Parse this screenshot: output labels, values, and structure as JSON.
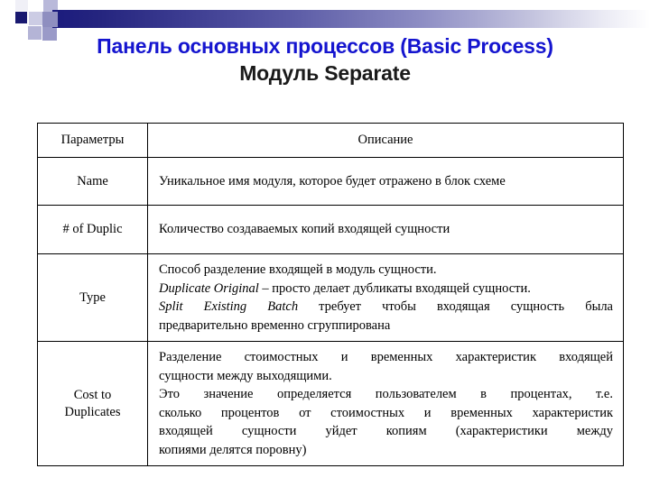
{
  "slide": {
    "title_line_1": "Панель основных процессов (Basic Process)",
    "title_line_2": "Модуль Separate",
    "title_color_1": "#1515cf",
    "title_color_2": "#1a1a1a",
    "banner_gradient_start": "#1b1b7d",
    "banner_gradient_end": "#ffffff",
    "accent_square_color": "#191970"
  },
  "table": {
    "headers": {
      "parameter": "Параметры",
      "description": "Описание"
    },
    "rows": [
      {
        "parameter": "Name",
        "description_lines": [
          {
            "text": "Уникальное имя модуля, которое будет отражено в блок схеме",
            "justify": false
          }
        ]
      },
      {
        "parameter": "# of Duplic",
        "description_lines": [
          {
            "text": "Количество создаваемых копий входящей сущности",
            "justify": false
          }
        ]
      },
      {
        "parameter": "Type",
        "description_lines": [
          {
            "text": "Способ разделение входящей в модуль сущности.",
            "justify": false
          },
          {
            "italic_prefix": "Duplicate Original",
            "text": " – просто делает дубликаты входящей сущности.",
            "justify": false
          },
          {
            "italic_prefix": "Split Existing Batch",
            "text": " требует чтобы входящая сущность была",
            "justify": true
          },
          {
            "text": "предварительно временно сгруппирована",
            "justify": false
          }
        ]
      },
      {
        "parameter": "Cost to Duplicates",
        "parameter_line_1": "Cost to",
        "parameter_line_2": "Duplicates",
        "description_lines": [
          {
            "text": "Разделение стоимостных и временных характеристик входящей",
            "justify": true
          },
          {
            "text": "сущности между выходящими.",
            "justify": false
          },
          {
            "text": "Это значение определяется пользователем в процентах, т.е.",
            "justify": true
          },
          {
            "text": "сколько процентов от стоимостных и временных характеристик",
            "justify": true
          },
          {
            "text": "входящей сущности уйдет копиям (характеристики между",
            "justify": true
          },
          {
            "text": "копиями делятся поровну)",
            "justify": false
          }
        ]
      }
    ]
  }
}
